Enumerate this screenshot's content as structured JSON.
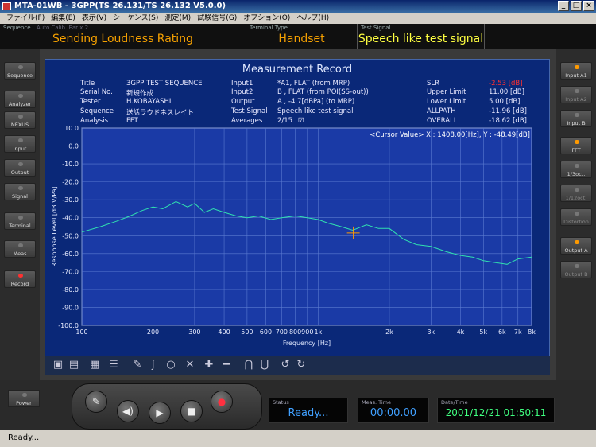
{
  "window": {
    "title": "MTA-01WB - 3GPP(TS 26.131/TS 26.132 V5.0.0)",
    "minimize_label": "_",
    "maximize_label": "□",
    "close_label": "×"
  },
  "menu": [
    "ファイル(F)",
    "編集(E)",
    "表示(V)",
    "シーケンス(S)",
    "測定(M)",
    "試験信号(G)",
    "オプション(O)",
    "ヘルプ(H)"
  ],
  "header": {
    "sequence_label": "Sequence",
    "sequence_sub": "Auto Calib.  Ear x 2",
    "sequence_value": "Sending Loudness Rating",
    "terminal_label": "Terminal Type",
    "terminal_value": "Handset",
    "signal_label": "Test Signal",
    "signal_value": "Speech like test signal"
  },
  "left_buttons": [
    "Sequence",
    "Analyzer",
    "NEXUS",
    "Input",
    "Output",
    "Signal",
    "Terminal",
    "Meas",
    "Record"
  ],
  "right_buttons": [
    "Input A1",
    "Input A2",
    "Input B",
    "FFT",
    "1/3oct.",
    "1/12oct.",
    "Distortion",
    "Output A",
    "Output B"
  ],
  "record": {
    "title": "Measurement Record",
    "fields": [
      {
        "k": "Title",
        "v": "3GPP TEST SEQUENCE"
      },
      {
        "k": "Serial No.",
        "v": "新規作成"
      },
      {
        "k": "Tester",
        "v": "H.KOBAYASHI"
      },
      {
        "k": "Sequence",
        "v": "送話ラウドネスレイト"
      },
      {
        "k": "Analysis",
        "v": "FFT"
      }
    ],
    "fields2": [
      {
        "k": "Input1",
        "v": "*A1, FLAT (from MRP)"
      },
      {
        "k": "Input2",
        "v": "B , FLAT (from POI(SS-out))"
      },
      {
        "k": "Output",
        "v": "A , -4.7[dBPa] (to MRP)"
      },
      {
        "k": "Test Signal",
        "v": "Speech like test signal"
      },
      {
        "k": "Averages",
        "v": "2/15"
      }
    ],
    "averages_mark": "☑",
    "results": [
      {
        "k": "SLR",
        "v": "-2.53 [dB]",
        "red": true
      },
      {
        "k": "Upper Limit",
        "v": "11.00 [dB]"
      },
      {
        "k": "Lower Limit",
        "v": "5.00 [dB]"
      },
      {
        "k": "ALLPATH",
        "v": "-11.96 [dB]"
      },
      {
        "k": "OVERALL",
        "v": "-18.62 [dB]"
      }
    ],
    "cursor_value": "<Cursor Value> X : 1408.00[Hz], Y : -48.49[dB]"
  },
  "chart_data": {
    "type": "line",
    "xlabel": "Frequency [Hz]",
    "ylabel": "Response Level [dB V/Pa]",
    "xscale": "log",
    "xlim": [
      100,
      8000
    ],
    "ylim": [
      -100,
      10
    ],
    "xticks": [
      100,
      200,
      300,
      400,
      500,
      600,
      700,
      800,
      900,
      1000,
      2000,
      3000,
      4000,
      5000,
      6000,
      7000,
      8000
    ],
    "xtick_labels": [
      "100",
      "200",
      "300",
      "400",
      "500",
      "600",
      "700",
      "800",
      "900",
      "1k",
      "2k",
      "3k",
      "4k",
      "5k",
      "6k",
      "7k",
      "8k"
    ],
    "yticks": [
      10,
      0,
      -10,
      -20,
      -30,
      -40,
      -50,
      -60,
      -70,
      -80,
      -90,
      -100
    ],
    "ytick_labels": [
      "10.0",
      "0.0",
      "-10.0",
      "-20.0",
      "-30.0",
      "-40.0",
      "-50.0",
      "-60.0",
      "-70.0",
      "-80.0",
      "-90.0",
      "-100.0"
    ],
    "grid": true,
    "line_color": "#30e0b0",
    "cursor": {
      "x": 1408,
      "y": -48.49
    },
    "series": [
      {
        "x": [
          100,
          120,
          140,
          160,
          180,
          200,
          220,
          250,
          280,
          300,
          330,
          360,
          400,
          450,
          500,
          560,
          630,
          700,
          800,
          900,
          1000,
          1100,
          1250,
          1400,
          1600,
          1800,
          2000,
          2300,
          2600,
          3000,
          3500,
          4000,
          4500,
          5000,
          5600,
          6300,
          7000,
          8000
        ],
        "y": [
          -48,
          -45,
          -42,
          -39,
          -36,
          -34,
          -35,
          -31,
          -34,
          -32,
          -37,
          -35,
          -37,
          -39,
          -40,
          -39,
          -41,
          -40,
          -39,
          -40,
          -41,
          -43,
          -45,
          -47,
          -44,
          -46,
          -46,
          -52,
          -55,
          -56,
          -59,
          -61,
          -62,
          -64,
          -65,
          -66,
          -63,
          -62
        ]
      }
    ]
  },
  "tools": [
    "save-icon",
    "print-icon",
    "chart-icon",
    "list-icon",
    "pen-icon",
    "eraser-icon",
    "circle-icon",
    "cross-icon",
    "plus-icon",
    "minus-icon",
    "zoom-in-icon",
    "zoom-out-icon",
    "rotate-left-icon",
    "rotate-right-icon"
  ],
  "bottom": {
    "power_label": "Power",
    "status_label": "Status",
    "status_value": "Ready...",
    "meas_label": "Meas. Time",
    "meas_value": "00:00.00",
    "date_label": "Date/Time",
    "date_value": "2001/12/21 01:50:11",
    "statusbar_text": "Ready..."
  },
  "colors": {
    "accent_orange": "#f5a000",
    "accent_yellow": "#ffff40",
    "plot_bg": "#1a3aa6",
    "grid": "#5a7ad0",
    "status_cyan": "#40a0ff",
    "time_green": "#40ff80"
  }
}
